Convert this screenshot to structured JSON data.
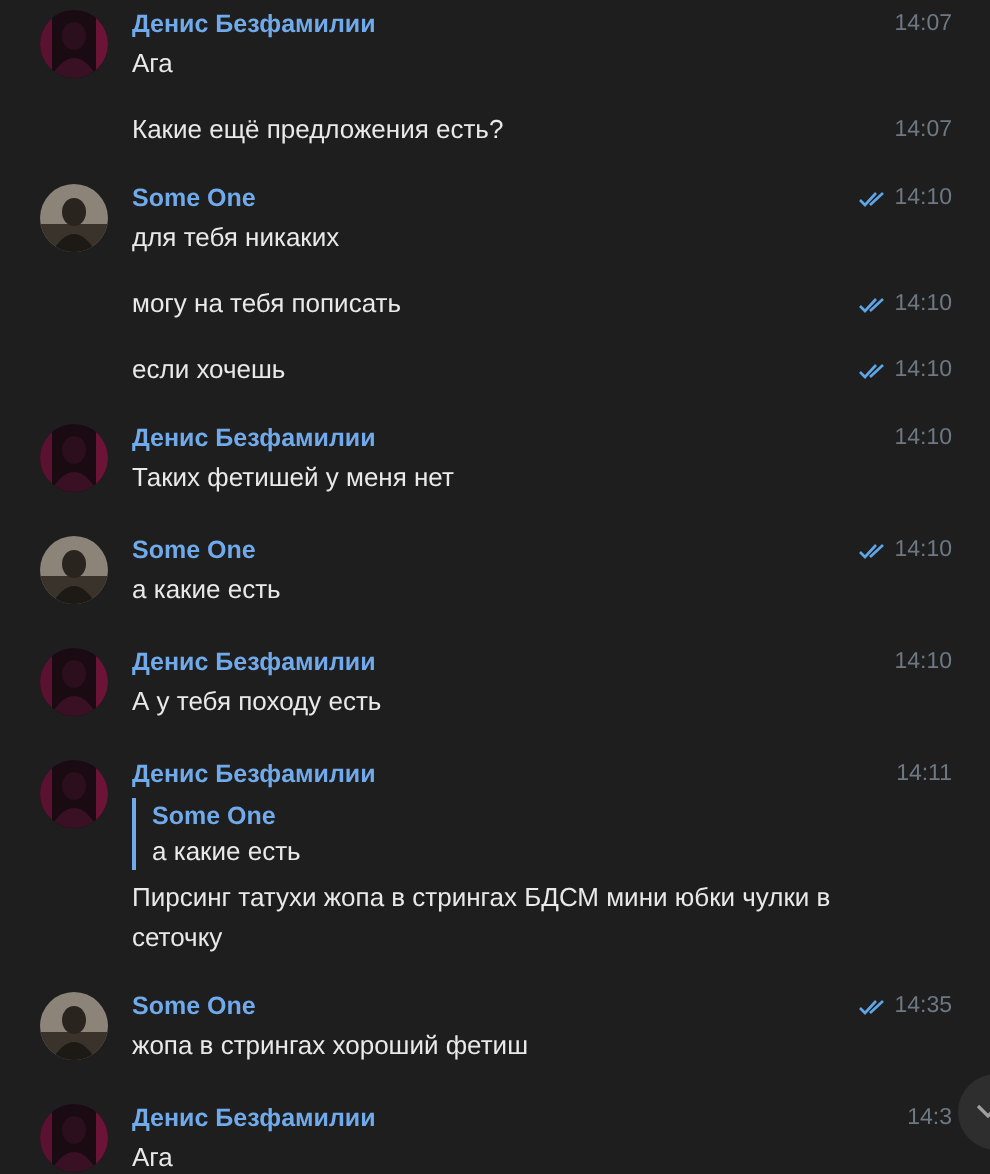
{
  "groups": [
    {
      "author": "Денис Безфамилии",
      "avatar": {
        "kind": "picture"
      },
      "messages": [
        {
          "text": "Ага",
          "time": "14:07",
          "read": false
        },
        {
          "text": "Какие ещё предложения есть?",
          "time": "14:07",
          "read": false
        }
      ]
    },
    {
      "author": "Some One",
      "avatar": {
        "kind": "picture"
      },
      "messages": [
        {
          "text": "для тебя никаких",
          "time": "14:10",
          "read": true
        },
        {
          "text": "могу на тебя пописать",
          "time": "14:10",
          "read": true
        },
        {
          "text": "если хочешь",
          "time": "14:10",
          "read": true
        }
      ]
    },
    {
      "author": "Денис Безфамилии",
      "avatar": {
        "kind": "picture"
      },
      "messages": [
        {
          "text": "Таких фетишей у меня нет",
          "time": "14:10",
          "read": false
        }
      ]
    },
    {
      "author": "Some One",
      "avatar": {
        "kind": "picture"
      },
      "messages": [
        {
          "text": "а какие есть",
          "time": "14:10",
          "read": true
        }
      ]
    },
    {
      "author": "Денис Безфамилии",
      "avatar": {
        "kind": "picture"
      },
      "messages": [
        {
          "text": "А у тебя походу есть",
          "time": "14:10",
          "read": false
        }
      ]
    },
    {
      "author": "Денис Безфамилии",
      "avatar": {
        "kind": "picture"
      },
      "messages": [
        {
          "reply": {
            "author": "Some One",
            "text": "а какие есть"
          },
          "text": "Пирсинг татухи жопа в стрингах БДСМ мини юбки чулки в сеточку",
          "time": "14:11",
          "read": false
        }
      ]
    },
    {
      "author": "Some One",
      "avatar": {
        "kind": "picture"
      },
      "messages": [
        {
          "text": "жопа в стрингах хороший фетиш",
          "time": "14:35",
          "read": true
        }
      ]
    },
    {
      "author": "Денис Безфамилии",
      "avatar": {
        "kind": "picture"
      },
      "messages": [
        {
          "text": "Ага",
          "time": "14:3",
          "read": false
        }
      ]
    }
  ]
}
